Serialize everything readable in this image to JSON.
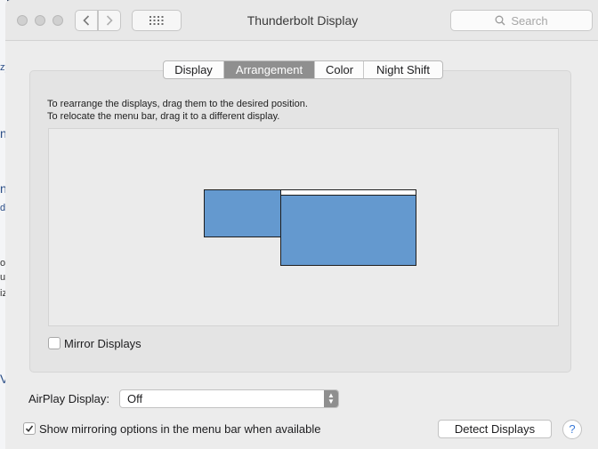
{
  "background_app": {
    "edge_glyphs": [
      "zy",
      "n",
      "n",
      "d",
      "o",
      "u",
      "iz",
      "V"
    ]
  },
  "window": {
    "title": "Thunderbolt Display",
    "search_placeholder": "Search",
    "nav": {
      "back_icon": "chevron-left",
      "forward_icon": "chevron-right",
      "grid_icon": "show-all-grid"
    }
  },
  "tabs": [
    {
      "label": "Display",
      "active": false
    },
    {
      "label": "Arrangement",
      "active": true
    },
    {
      "label": "Color",
      "active": false
    },
    {
      "label": "Night Shift",
      "active": false
    }
  ],
  "instructions": {
    "line1": "To rearrange the displays, drag them to the desired position.",
    "line2": "To relocate the menu bar, drag it to a different display."
  },
  "arrangement": {
    "display_color": "#6499cf",
    "menu_bar_on": "right display"
  },
  "mirror": {
    "label": "Mirror Displays",
    "checked": false
  },
  "airplay": {
    "label": "AirPlay Display:",
    "value": "Off"
  },
  "show_mirroring": {
    "label": "Show mirroring options in the menu bar when available",
    "checked": true
  },
  "detect_button": "Detect Displays",
  "help_label": "?"
}
